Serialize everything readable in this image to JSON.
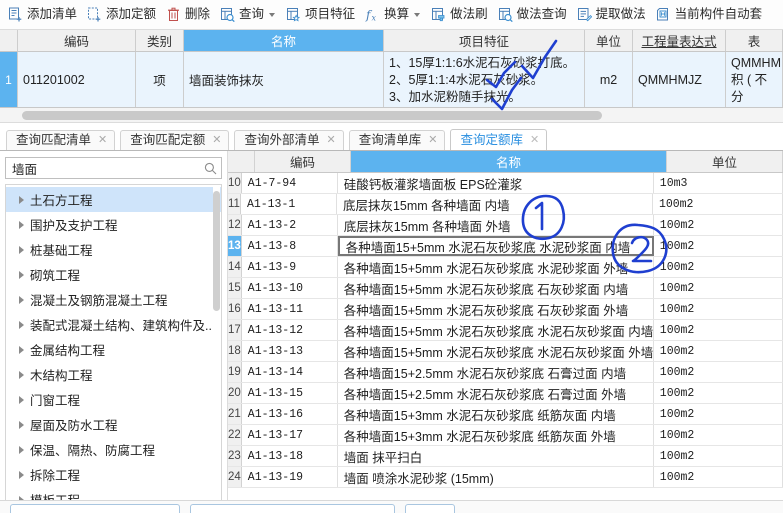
{
  "toolbar": {
    "items": [
      {
        "label": "添加清单",
        "icon": "add-list-icon",
        "caret": false
      },
      {
        "label": "添加定额",
        "icon": "add-quota-icon",
        "caret": false
      },
      {
        "label": "删除",
        "icon": "trash-icon",
        "caret": false
      },
      {
        "label": "查询",
        "icon": "query-icon",
        "caret": true
      },
      {
        "label": "项目特征",
        "icon": "project-feature-icon",
        "caret": false
      },
      {
        "label": "换算",
        "icon": "fx-icon",
        "caret": true
      },
      {
        "label": "做法刷",
        "icon": "method-brush-icon",
        "caret": false
      },
      {
        "label": "做法查询",
        "icon": "method-query-icon",
        "caret": false
      },
      {
        "label": "提取做法",
        "icon": "extract-method-icon",
        "caret": false
      },
      {
        "label": "当前构件自动套",
        "icon": "auto-match-icon",
        "caret": false
      }
    ]
  },
  "top_grid": {
    "headers": {
      "index": "",
      "code": "编码",
      "kind": "类别",
      "name": "名称",
      "feature": "项目特征",
      "unit": "单位",
      "expression": "工程量表达式",
      "last": "表"
    },
    "selected_header": "名称",
    "rows": [
      {
        "no": "1",
        "code": "011201002",
        "kind": "项",
        "name": "墙面装饰抹灰",
        "feature": "1、15厚1:1:6水泥石灰砂浆打底。\n2、5厚1:1:4水泥石灰砂浆。\n3、加水泥粉随手抹光。",
        "unit": "m2",
        "expression": "QMMHMJZ",
        "last": "QMMHM\n积 ( 不分"
      }
    ]
  },
  "tabs": [
    {
      "label": "查询匹配清单",
      "active": false
    },
    {
      "label": "查询匹配定额",
      "active": false
    },
    {
      "label": "查询外部清单",
      "active": false
    },
    {
      "label": "查询清单库",
      "active": false
    },
    {
      "label": "查询定额库",
      "active": true
    }
  ],
  "tab_close_glyph": "✕",
  "sidebar": {
    "search": {
      "value": "墙面",
      "placeholder": "",
      "icon": "search-icon"
    },
    "items": [
      {
        "label": "土石方工程",
        "selected": true
      },
      {
        "label": "围护及支护工程",
        "selected": false
      },
      {
        "label": "桩基础工程",
        "selected": false
      },
      {
        "label": "砌筑工程",
        "selected": false
      },
      {
        "label": "混凝土及钢筋混凝土工程",
        "selected": false
      },
      {
        "label": "装配式混凝土结构、建筑构件及...",
        "selected": false
      },
      {
        "label": "金属结构工程",
        "selected": false
      },
      {
        "label": "木结构工程",
        "selected": false
      },
      {
        "label": "门窗工程",
        "selected": false
      },
      {
        "label": "屋面及防水工程",
        "selected": false
      },
      {
        "label": "保温、隔热、防腐工程",
        "selected": false
      },
      {
        "label": "拆除工程",
        "selected": false
      },
      {
        "label": "模板工程",
        "selected": false
      }
    ]
  },
  "data_grid": {
    "headers": {
      "no": "",
      "code": "编码",
      "name": "名称",
      "unit": "单位"
    },
    "selected_header": "名称",
    "rows": [
      {
        "no": "10",
        "code": "A1-7-94",
        "name": "硅酸钙板灌浆墙面板 EPS砼灌浆",
        "unit": "10m3",
        "selected": false
      },
      {
        "no": "11",
        "code": "A1-13-1",
        "name": "底层抹灰15mm  各种墙面 内墙",
        "unit": "100m2",
        "selected": false
      },
      {
        "no": "12",
        "code": "A1-13-2",
        "name": "底层抹灰15mm  各种墙面 外墙",
        "unit": "100m2",
        "selected": false
      },
      {
        "no": "13",
        "code": "A1-13-8",
        "name": "各种墙面15+5mm  水泥石灰砂浆底  水泥砂浆面 内墙",
        "unit": "100m2",
        "selected": true
      },
      {
        "no": "14",
        "code": "A1-13-9",
        "name": "各种墙面15+5mm  水泥石灰砂浆底  水泥砂浆面 外墙",
        "unit": "100m2",
        "selected": false
      },
      {
        "no": "15",
        "code": "A1-13-10",
        "name": "各种墙面15+5mm  水泥石灰砂浆底  石灰砂浆面 内墙",
        "unit": "100m2",
        "selected": false
      },
      {
        "no": "16",
        "code": "A1-13-11",
        "name": "各种墙面15+5mm  水泥石灰砂浆底  石灰砂浆面 外墙",
        "unit": "100m2",
        "selected": false
      },
      {
        "no": "17",
        "code": "A1-13-12",
        "name": "各种墙面15+5mm  水泥石灰砂浆底  水泥石灰砂浆面 内墙",
        "unit": "100m2",
        "selected": false
      },
      {
        "no": "18",
        "code": "A1-13-13",
        "name": "各种墙面15+5mm  水泥石灰砂浆底  水泥石灰砂浆面 外墙",
        "unit": "100m2",
        "selected": false
      },
      {
        "no": "19",
        "code": "A1-13-14",
        "name": "各种墙面15+2.5mm  水泥石灰砂浆底  石膏过面 内墙",
        "unit": "100m2",
        "selected": false
      },
      {
        "no": "20",
        "code": "A1-13-15",
        "name": "各种墙面15+2.5mm  水泥石灰砂浆底  石膏过面 外墙",
        "unit": "100m2",
        "selected": false
      },
      {
        "no": "21",
        "code": "A1-13-16",
        "name": "各种墙面15+3mm  水泥石灰砂浆底  纸筋灰面 内墙",
        "unit": "100m2",
        "selected": false
      },
      {
        "no": "22",
        "code": "A1-13-17",
        "name": "各种墙面15+3mm  水泥石灰砂浆底  纸筋灰面 外墙",
        "unit": "100m2",
        "selected": false
      },
      {
        "no": "23",
        "code": "A1-13-18",
        "name": "墙面  抹平扫白",
        "unit": "100m2",
        "selected": false
      },
      {
        "no": "24",
        "code": "A1-13-19",
        "name": "墙面  喷涂水泥砂浆 (15mm)",
        "unit": "100m2",
        "selected": false
      }
    ]
  },
  "colors": {
    "accent": "#5cb3ef",
    "selection": "#cfe4fa",
    "row_fill": "#eaf4fd",
    "ink": "#1f3fd0",
    "tab_active_text": "#2a8fe0"
  }
}
